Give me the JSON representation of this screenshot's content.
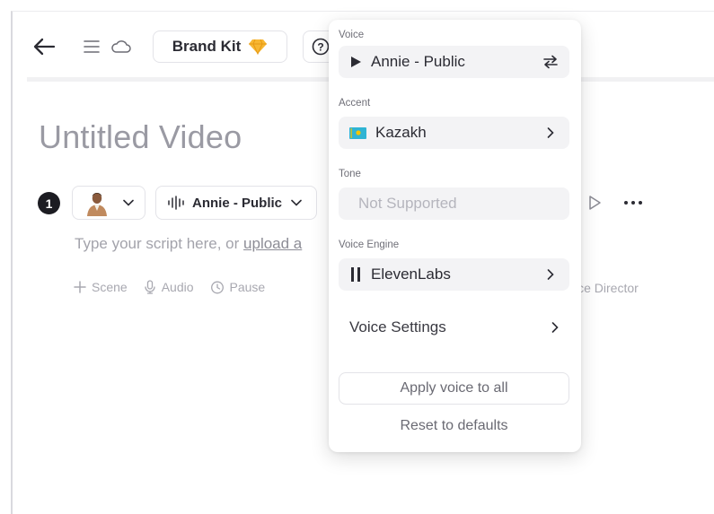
{
  "header": {
    "brand_kit_label": "Brand Kit",
    "help_glyph": "?",
    "icons": {
      "back": "arrow-left-icon",
      "menu": "hamburger-menu-icon",
      "cloud": "cloud-icon",
      "brand": "diamond-icon",
      "help": "question-circle-icon"
    }
  },
  "video": {
    "title": "Untitled Video"
  },
  "scene": {
    "number": "1",
    "voice_label": "Annie - Public",
    "script_placeholder": "Type your script here, or ",
    "upload_link": "upload a",
    "actions": [
      {
        "label": "Scene",
        "icon": "plus-icon"
      },
      {
        "label": "Audio",
        "icon": "microphone-icon"
      },
      {
        "label": "Pause",
        "icon": "timer-icon"
      }
    ],
    "voice_director_label": "ice Director"
  },
  "voice_panel": {
    "voice_label": "Voice",
    "voice_value": "Annie - Public",
    "accent_label": "Accent",
    "accent_value": "Kazakh",
    "tone_label": "Tone",
    "tone_value": "Not Supported",
    "engine_label": "Voice Engine",
    "engine_value": "ElevenLabs",
    "settings_label": "Voice Settings",
    "apply_label": "Apply voice to all",
    "reset_label": "Reset to defaults"
  },
  "colors": {
    "accent_flag": "#2fb4d4",
    "flag_sun": "#f2c500",
    "brand_diamond": "#f7b733",
    "text_dark": "#2b2b33",
    "text_muted": "#a3a3ab"
  }
}
